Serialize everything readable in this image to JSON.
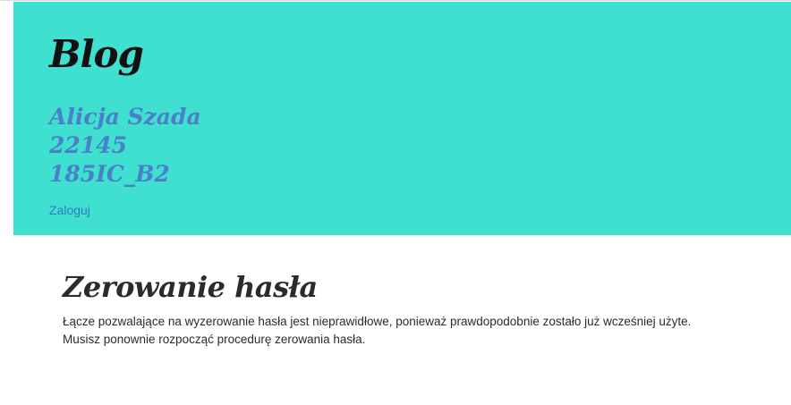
{
  "header": {
    "title": "Blog",
    "author_lines": [
      "Alicja Szada",
      "22145",
      "185IC_B2"
    ],
    "login_label": "Zaloguj",
    "background_color": "#40e0d0",
    "author_color": "#4a80c8"
  },
  "main": {
    "title": "Zerowanie hasła",
    "message_lines": [
      "Łącze pozwalające na wyzerowanie hasła jest nieprawidłowe, ponieważ prawdopodobnie zostało już wcześniej użyte.",
      "Musisz ponownie rozpocząć procedurę zerowania hasła."
    ]
  }
}
